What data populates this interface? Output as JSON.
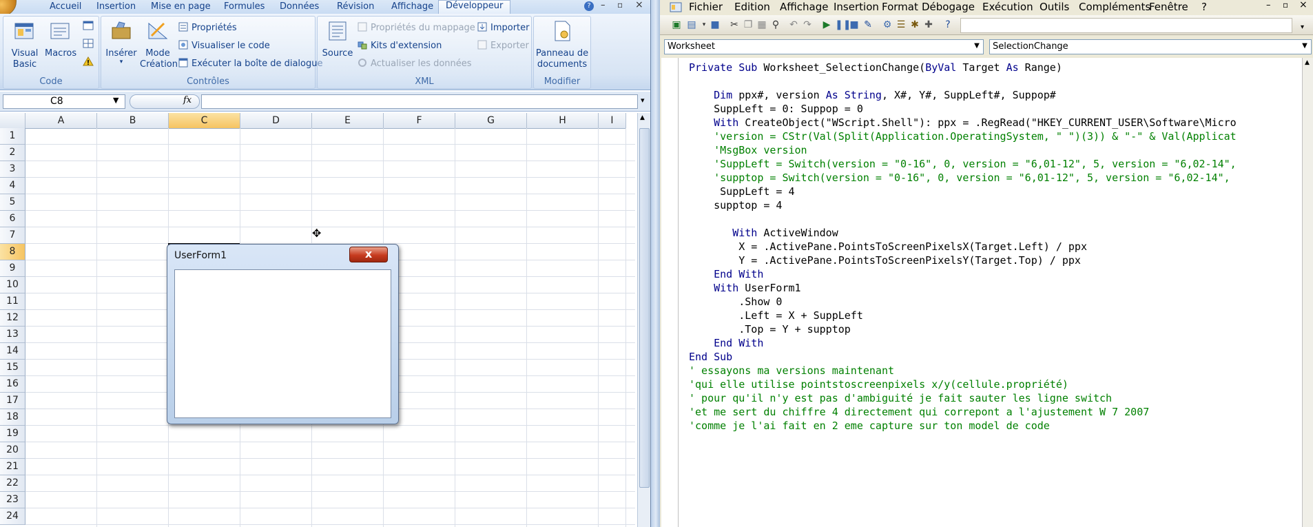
{
  "excel": {
    "tabs": [
      "Accueil",
      "Insertion",
      "Mise en page",
      "Formules",
      "Données",
      "Révision",
      "Affichage",
      "Développeur"
    ],
    "active_tab": "Développeur",
    "groups": {
      "code": {
        "label": "Code",
        "visual_basic": "Visual Basic",
        "macros": "Macros"
      },
      "controles": {
        "label": "Contrôles",
        "inserer": "Insérer",
        "mode_creation_1": "Mode",
        "mode_creation_2": "Création",
        "proprietes": "Propriétés",
        "visualiser_code": "Visualiser le code",
        "executer_dialogue": "Exécuter la boîte de dialogue"
      },
      "xml": {
        "label": "XML",
        "source": "Source",
        "proprietes_mappage": "Propriétés du mappage",
        "kits_extension": "Kits d'extension",
        "actualiser_donnees": "Actualiser les données",
        "importer": "Importer",
        "exporter": "Exporter"
      },
      "modifier": {
        "label": "Modifier",
        "panneau_1": "Panneau de",
        "panneau_2": "documents"
      }
    },
    "name_box": "C8",
    "fx_label": "fx",
    "columns": [
      "A",
      "B",
      "C",
      "D",
      "E",
      "F",
      "G",
      "H",
      "I"
    ],
    "selected_column": "C",
    "rows": [
      "1",
      "2",
      "3",
      "4",
      "5",
      "6",
      "7",
      "8",
      "9",
      "10",
      "11",
      "12",
      "13",
      "14",
      "15",
      "16",
      "17",
      "18",
      "19",
      "20",
      "21",
      "22",
      "23",
      "24"
    ],
    "selected_row": "8"
  },
  "userform": {
    "title": "UserForm1",
    "close_glyph": "x"
  },
  "vbe": {
    "menu": [
      "Fichier",
      "Edition",
      "Affichage",
      "Insertion",
      "Format",
      "Débogage",
      "Exécution",
      "Outils",
      "Compléments",
      "Fenêtre",
      "?"
    ],
    "object_combo": "Worksheet",
    "procedure_combo": "SelectionChange",
    "code_lines": [
      {
        "t": "Private Sub Worksheet_SelectionChange(ByVal Target As Range)",
        "k": "sub"
      },
      {
        "t": "",
        "k": "n"
      },
      {
        "t": "    Dim ppx#, version As String, X#, Y#, SuppLeft#, Suppop#",
        "k": "dim"
      },
      {
        "t": "    SuppLeft = 0: Suppop = 0",
        "k": "n"
      },
      {
        "t": "    With CreateObject(\"WScript.Shell\"): ppx = .RegRead(\"HKEY_CURRENT_USER\\Software\\Micro",
        "k": "with"
      },
      {
        "t": "    'version = CStr(Val(Split(Application.OperatingSystem, \" \")(3)) & \"-\" & Val(Applicat",
        "k": "c"
      },
      {
        "t": "    'MsgBox version",
        "k": "c"
      },
      {
        "t": "    'SuppLeft = Switch(version = \"0-16\", 0, version = \"6,01-12\", 5, version = \"6,02-14\",",
        "k": "c"
      },
      {
        "t": "    'supptop = Switch(version = \"0-16\", 0, version = \"6,01-12\", 5, version = \"6,02-14\",",
        "k": "c"
      },
      {
        "t": "     SuppLeft = 4",
        "k": "n"
      },
      {
        "t": "    supptop = 4",
        "k": "n"
      },
      {
        "t": "",
        "k": "n"
      },
      {
        "t": "       With ActiveWindow",
        "k": "with"
      },
      {
        "t": "        X = .ActivePane.PointsToScreenPixelsX(Target.Left) / ppx",
        "k": "n"
      },
      {
        "t": "        Y = .ActivePane.PointsToScreenPixelsY(Target.Top) / ppx",
        "k": "n"
      },
      {
        "t": "    End With",
        "k": "end"
      },
      {
        "t": "    With UserForm1",
        "k": "with"
      },
      {
        "t": "        .Show 0",
        "k": "n"
      },
      {
        "t": "        .Left = X + SuppLeft",
        "k": "n"
      },
      {
        "t": "        .Top = Y + supptop",
        "k": "n"
      },
      {
        "t": "    End With",
        "k": "end"
      },
      {
        "t": "End Sub",
        "k": "end"
      },
      {
        "t": "' essayons ma versions maintenant",
        "k": "c"
      },
      {
        "t": "'qui elle utilise pointstoscreenpixels x/y(cellule.propriété)",
        "k": "c"
      },
      {
        "t": "' pour qu'il n'y est pas d'ambiguité je fait sauter les ligne switch",
        "k": "c"
      },
      {
        "t": "'et me sert du chiffre 4 directement qui correpont a l'ajustement W 7 2007",
        "k": "c"
      },
      {
        "t": "'comme je l'ai fait en 2 eme capture sur ton model de code",
        "k": "c"
      }
    ]
  }
}
